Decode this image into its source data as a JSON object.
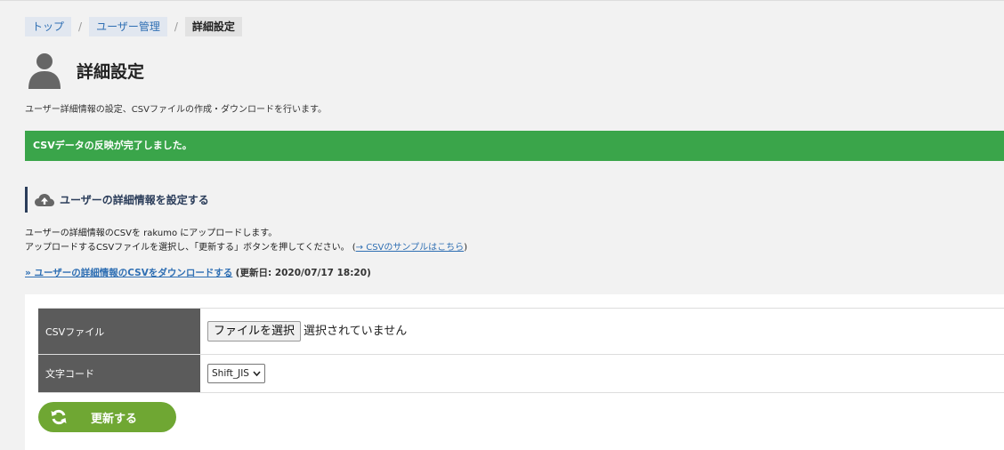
{
  "breadcrumb": {
    "items": [
      "トップ",
      "ユーザー管理"
    ],
    "current": "詳細設定",
    "separator": "/"
  },
  "page": {
    "title": "詳細設定",
    "description": "ユーザー詳細情報の設定、CSVファイルの作成・ダウンロードを行います。",
    "icon": "person-icon"
  },
  "banner": {
    "message": "CSVデータの反映が完了しました。",
    "color": "#3aa54a"
  },
  "section": {
    "icon": "cloud-upload-icon",
    "title": "ユーザーの詳細情報を設定する",
    "line1": "ユーザーの詳細情報のCSVを rakumo にアップロードします。",
    "line2_prefix": "アップロードするCSVファイルを選択し、「更新する」ボタンを押してください。 (",
    "sample_link": "→ CSVのサンプルはこちら",
    "line2_suffix": ")"
  },
  "download": {
    "link": "» ユーザーの詳細情報のCSVをダウンロードする",
    "note": "(更新日: 2020/07/17 18:20)"
  },
  "form": {
    "csv_label": "CSVファイル",
    "file_button": "ファイルを選択",
    "file_status": "選択されていません",
    "encoding_label": "文字コード",
    "encoding_value": "Shift_JIS"
  },
  "actions": {
    "update_label": "更新する",
    "update_icon": "refresh-icon",
    "update_color": "#6fa733"
  }
}
